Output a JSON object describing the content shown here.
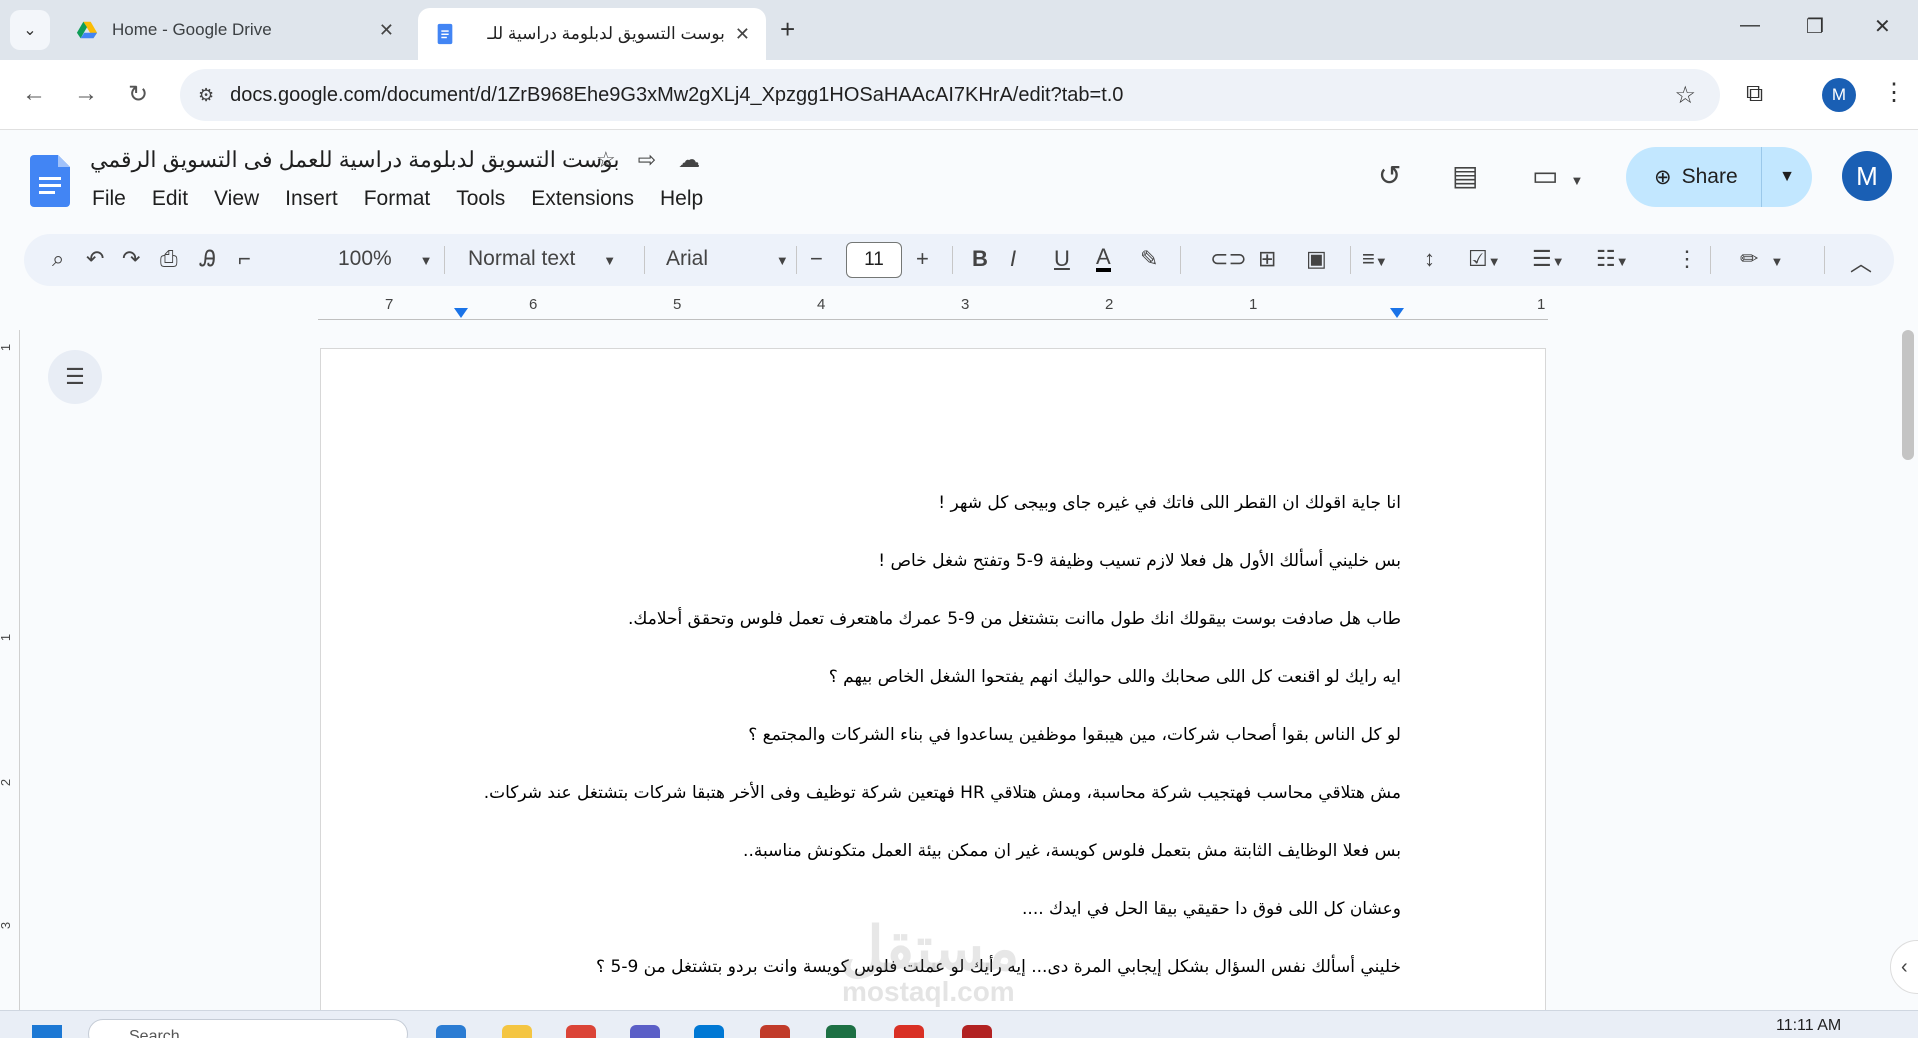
{
  "browser": {
    "tabs": [
      {
        "title": "Home - Google Drive",
        "active": false
      },
      {
        "title": "بوست التسويق لدبلومة دراسية للـ",
        "active": true
      }
    ],
    "url": "docs.google.com/document/d/1ZrB968Ehe9G3xMw2gXLj4_Xpzgg1HOSaHAAcAI7KHrA/edit?tab=t.0",
    "profile_initial": "M"
  },
  "docs": {
    "title": "بوست التسويق لدبلومة دراسية للعمل فى التسويق الرقمي",
    "menu": [
      "File",
      "Edit",
      "View",
      "Insert",
      "Format",
      "Tools",
      "Extensions",
      "Help"
    ],
    "share_label": "Share",
    "avatar_initial": "M"
  },
  "format_bar": {
    "zoom": "100%",
    "style": "Normal text",
    "font": "Arial",
    "font_size": "11"
  },
  "ruler": {
    "numbers": [
      "7",
      "6",
      "5",
      "4",
      "3",
      "2",
      "1",
      "1"
    ],
    "vertical_numbers": [
      "1",
      "1",
      "2",
      "3"
    ]
  },
  "document": {
    "lines": [
      "انا جاية اقولك ان القطر اللى فاتك في غيره جاى وبيجى كل شهر !",
      "بس خليني أسألك الأول هل فعلا لازم تسيب وظيفة 9-5 وتفتح شغل خاص !",
      "طاب هل صادفت بوست بيقولك  انك طول ماانت بتشتغل من 9-5 عمرك ماهتعرف تعمل فلوس وتحقق أحلامك.",
      "ايه رايك لو اقنعت كل اللى صحابك واللى حواليك انهم يفتحوا الشغل الخاص بيهم ؟",
      "لو كل الناس بقوا أصحاب شركات، مين هيبقوا موظفين يساعدوا في بناء الشركات والمجتمع ؟",
      "مش هتلاقي محاسب فهتجيب شركة محاسبة، ومش هتلاقي HR  فهتعين شركة توظيف وفى الأخر هتبقا شركات بتشتغل عند شركات.",
      "بس فعلا الوظايف الثابتة مش بتعمل فلوس كويسة، غير ان ممكن بيئة العمل متكونش مناسبة..",
      "وعشان كل اللى فوق دا حقيقي بيقا الحل في ايدك ....",
      "خليني أسألك نفس السؤال بشكل إيجابي المرة دى... إيه رأيك لو عملت فلوس كويسة وانت بردو بتشتغل من 9-5 ؟"
    ]
  },
  "watermark": {
    "main": "مستقل",
    "sub": "mostaql.com"
  },
  "taskbar": {
    "search_placeholder": "Search",
    "time": "11:11 AM"
  },
  "colors": {
    "accent": "#1a73e8",
    "share_bg": "#c2e7ff",
    "avatar": "#1a5fb4"
  }
}
